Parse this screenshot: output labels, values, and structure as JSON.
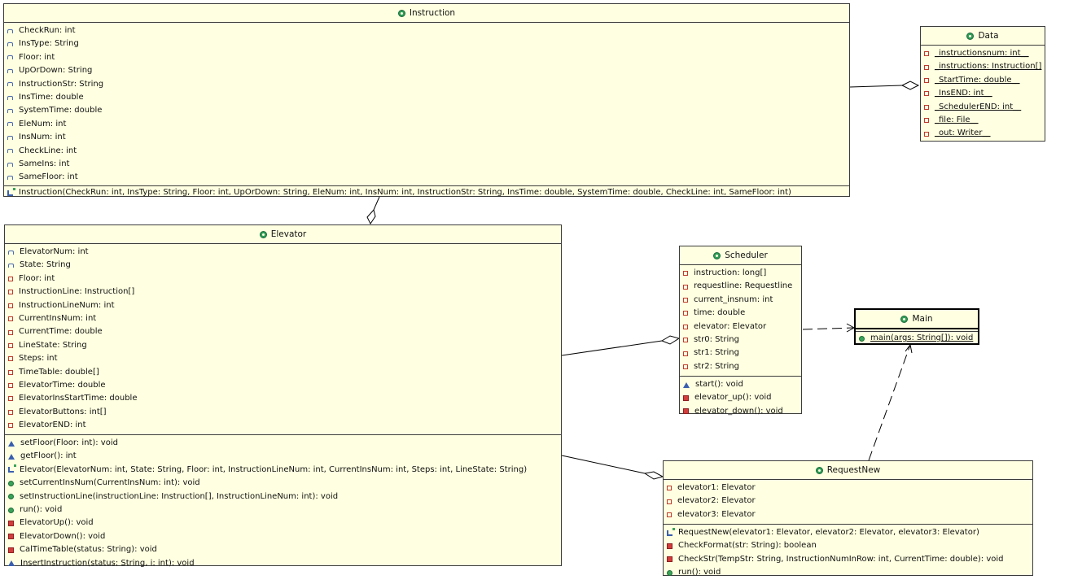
{
  "classes": {
    "instruction": {
      "name": "Instruction",
      "attributes": [
        {
          "icon": "package-field-icon",
          "text": "CheckRun: int"
        },
        {
          "icon": "package-field-icon",
          "text": "InsType: String"
        },
        {
          "icon": "package-field-icon",
          "text": "Floor: int"
        },
        {
          "icon": "package-field-icon",
          "text": "UpOrDown: String"
        },
        {
          "icon": "package-field-icon",
          "text": "InstructionStr: String"
        },
        {
          "icon": "package-field-icon",
          "text": "InsTime: double"
        },
        {
          "icon": "package-field-icon",
          "text": "SystemTime: double"
        },
        {
          "icon": "package-field-icon",
          "text": "EleNum: int"
        },
        {
          "icon": "package-field-icon",
          "text": "InsNum: int"
        },
        {
          "icon": "package-field-icon",
          "text": "CheckLine: int"
        },
        {
          "icon": "package-field-icon",
          "text": "SameIns: int"
        },
        {
          "icon": "package-field-icon",
          "text": "SameFloor: int"
        }
      ],
      "methods": [
        {
          "icon": "constructor-icon",
          "text": "Instruction(CheckRun: int, InsType: String, Floor: int, UpOrDown: String, EleNum: int, InsNum: int, InstructionStr: String, InsTime: double, SystemTime: double, CheckLine: int, SameFloor: int)"
        }
      ]
    },
    "data": {
      "name": "Data",
      "attributes": [
        {
          "icon": "private-field-icon",
          "text": "_instructionsnum: int__"
        },
        {
          "icon": "private-field-icon",
          "text": "_instructions: Instruction[]"
        },
        {
          "icon": "private-field-icon",
          "text": "_StartTime: double__"
        },
        {
          "icon": "private-field-icon",
          "text": "_InsEND: int__"
        },
        {
          "icon": "private-field-icon",
          "text": "_SchedulerEND: int__"
        },
        {
          "icon": "private-field-icon",
          "text": "_file: File__"
        },
        {
          "icon": "private-field-icon",
          "text": "_out: Writer__"
        }
      ]
    },
    "elevator": {
      "name": "Elevator",
      "attributes": [
        {
          "icon": "package-field-icon",
          "text": "ElevatorNum: int"
        },
        {
          "icon": "package-field-icon",
          "text": "State: String"
        },
        {
          "icon": "private-field-icon",
          "text": "Floor: int"
        },
        {
          "icon": "private-field-icon",
          "text": "InstructionLine: Instruction[]"
        },
        {
          "icon": "private-field-icon",
          "text": "InstructionLineNum: int"
        },
        {
          "icon": "private-field-icon",
          "text": "CurrentInsNum: int"
        },
        {
          "icon": "private-field-icon",
          "text": "CurrentTime: double"
        },
        {
          "icon": "private-field-icon",
          "text": "LineState: String"
        },
        {
          "icon": "private-field-icon",
          "text": "Steps: int"
        },
        {
          "icon": "private-field-icon",
          "text": "TimeTable: double[]"
        },
        {
          "icon": "private-field-icon",
          "text": "ElevatorTime: double"
        },
        {
          "icon": "private-field-icon",
          "text": "ElevatorInsStartTime: double"
        },
        {
          "icon": "private-field-icon",
          "text": "ElevatorButtons: int[]"
        },
        {
          "icon": "private-field-icon",
          "text": "ElevatorEND: int"
        }
      ],
      "methods": [
        {
          "icon": "package-method-icon",
          "text": "setFloor(Floor: int): void"
        },
        {
          "icon": "package-method-icon",
          "text": "getFloor(): int"
        },
        {
          "icon": "constructor-icon",
          "text": "Elevator(ElevatorNum: int, State: String, Floor: int, InstructionLineNum: int, CurrentInsNum: int, Steps: int, LineState: String)"
        },
        {
          "icon": "public-method-icon",
          "text": "setCurrentInsNum(CurrentInsNum: int): void"
        },
        {
          "icon": "public-method-icon",
          "text": "setInstructionLine(instructionLine: Instruction[], InstructionLineNum: int): void"
        },
        {
          "icon": "public-method-icon",
          "text": "run(): void"
        },
        {
          "icon": "private-method-icon",
          "text": "ElevatorUp(): void"
        },
        {
          "icon": "private-method-icon",
          "text": "ElevatorDown(): void"
        },
        {
          "icon": "private-method-icon",
          "text": "CalTimeTable(status: String): void"
        },
        {
          "icon": "package-method-icon",
          "text": "InsertInstruction(status: String, i: int): void"
        }
      ]
    },
    "scheduler": {
      "name": "Scheduler",
      "attributes": [
        {
          "icon": "private-field-icon",
          "text": "instruction: long[]"
        },
        {
          "icon": "private-field-icon",
          "text": "requestline: Requestline"
        },
        {
          "icon": "private-field-icon",
          "text": "current_insnum: int"
        },
        {
          "icon": "private-field-icon",
          "text": "time: double"
        },
        {
          "icon": "private-field-icon",
          "text": "elevator: Elevator"
        },
        {
          "icon": "private-field-icon",
          "text": "str0: String"
        },
        {
          "icon": "private-field-icon",
          "text": "str1: String"
        },
        {
          "icon": "private-field-icon",
          "text": "str2: String"
        }
      ],
      "methods": [
        {
          "icon": "package-method-icon",
          "text": "start(): void"
        },
        {
          "icon": "private-method-icon",
          "text": "elevator_up(): void"
        },
        {
          "icon": "private-method-icon",
          "text": "elevator_down(): void"
        }
      ]
    },
    "main": {
      "name": "Main",
      "methods": [
        {
          "icon": "public-method-icon",
          "text": "main(args: String[]): void"
        }
      ]
    },
    "requestnew": {
      "name": "RequestNew",
      "attributes": [
        {
          "icon": "private-field-icon",
          "text": "elevator1: Elevator"
        },
        {
          "icon": "private-field-icon",
          "text": "elevator2: Elevator"
        },
        {
          "icon": "private-field-icon",
          "text": "elevator3: Elevator"
        }
      ],
      "methods": [
        {
          "icon": "constructor-icon",
          "text": "RequestNew(elevator1: Elevator, elevator2: Elevator, elevator3: Elevator)"
        },
        {
          "icon": "private-method-icon",
          "text": "CheckFormat(str: String): boolean"
        },
        {
          "icon": "private-method-icon",
          "text": "CheckStr(TempStr: String, InstructionNumInRow: int, CurrentTime: double): void"
        },
        {
          "icon": "public-method-icon",
          "text": "run(): void"
        }
      ]
    }
  },
  "colors": {
    "class_fill": "#ffffe1",
    "class_border": "#3c3c3c",
    "class_icon": "#2e9e5a",
    "edge": "#000000"
  }
}
